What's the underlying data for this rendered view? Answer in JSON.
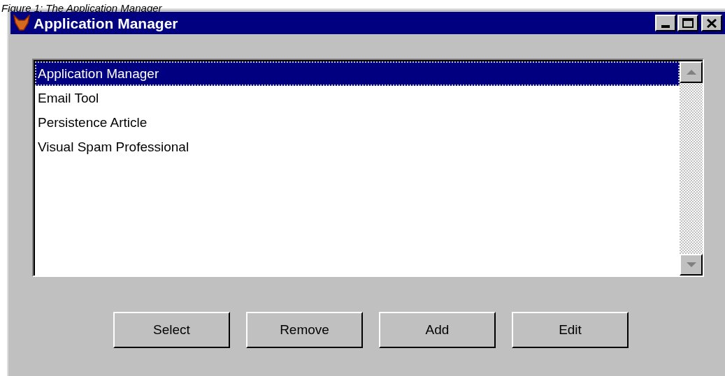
{
  "caption": "Figure 1: The Application Manager",
  "window": {
    "title": "Application Manager"
  },
  "list": {
    "items": [
      {
        "label": "Application Manager",
        "selected": true
      },
      {
        "label": "Email Tool",
        "selected": false
      },
      {
        "label": "Persistence Article",
        "selected": false
      },
      {
        "label": "Visual Spam Professional",
        "selected": false
      }
    ]
  },
  "buttons": [
    "Select",
    "Remove",
    "Add",
    "Edit"
  ]
}
